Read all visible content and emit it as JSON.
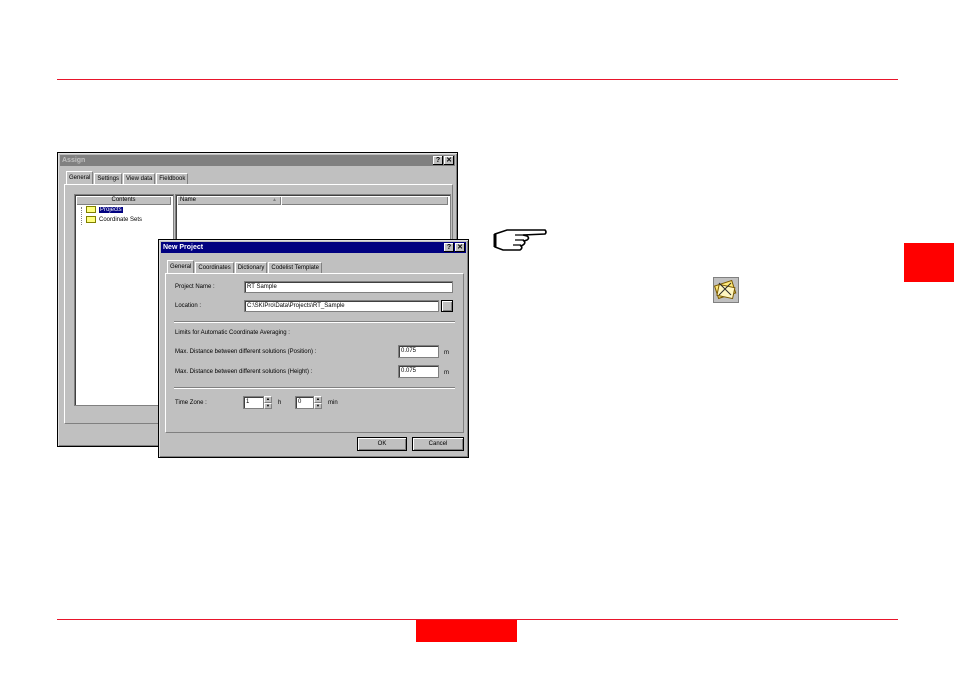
{
  "brand": {
    "accent": "#ff0000"
  },
  "assign_window": {
    "title": "Assign",
    "help_btn": "?",
    "close_btn": "✕",
    "tabs": [
      "General",
      "Settings",
      "View data",
      "Fieldbook"
    ],
    "contents_header": "Contents",
    "tree": [
      "Projects",
      "Coordinate Sets"
    ],
    "name_header": "Name"
  },
  "new_project": {
    "title": "New Project",
    "help_btn": "?",
    "close_btn": "✕",
    "tabs": [
      "General",
      "Coordinates",
      "Dictionary",
      "Codelist Template"
    ],
    "project_name_label": "Project Name :",
    "project_name_value": "RT Sample",
    "location_label": "Location :",
    "location_value": "C:\\SKIPro\\Data\\Projects\\RT_Sample",
    "limits_label": "Limits for Automatic Coordinate Averaging :",
    "pos_label": "Max. Distance between different solutions (Position) :",
    "pos_value": "0.075",
    "pos_unit": "m",
    "height_label": "Max. Distance between different solutions (Height) :",
    "height_value": "0.075",
    "height_unit": "m",
    "timezone_label": "Time Zone :",
    "tz_hours": "1",
    "tz_h_unit": "h",
    "tz_minutes": "0",
    "tz_min_unit": "min",
    "ok": "OK",
    "cancel": "Cancel"
  },
  "icons": [
    "hand-pointing-icon",
    "project-toolbar-icon"
  ]
}
